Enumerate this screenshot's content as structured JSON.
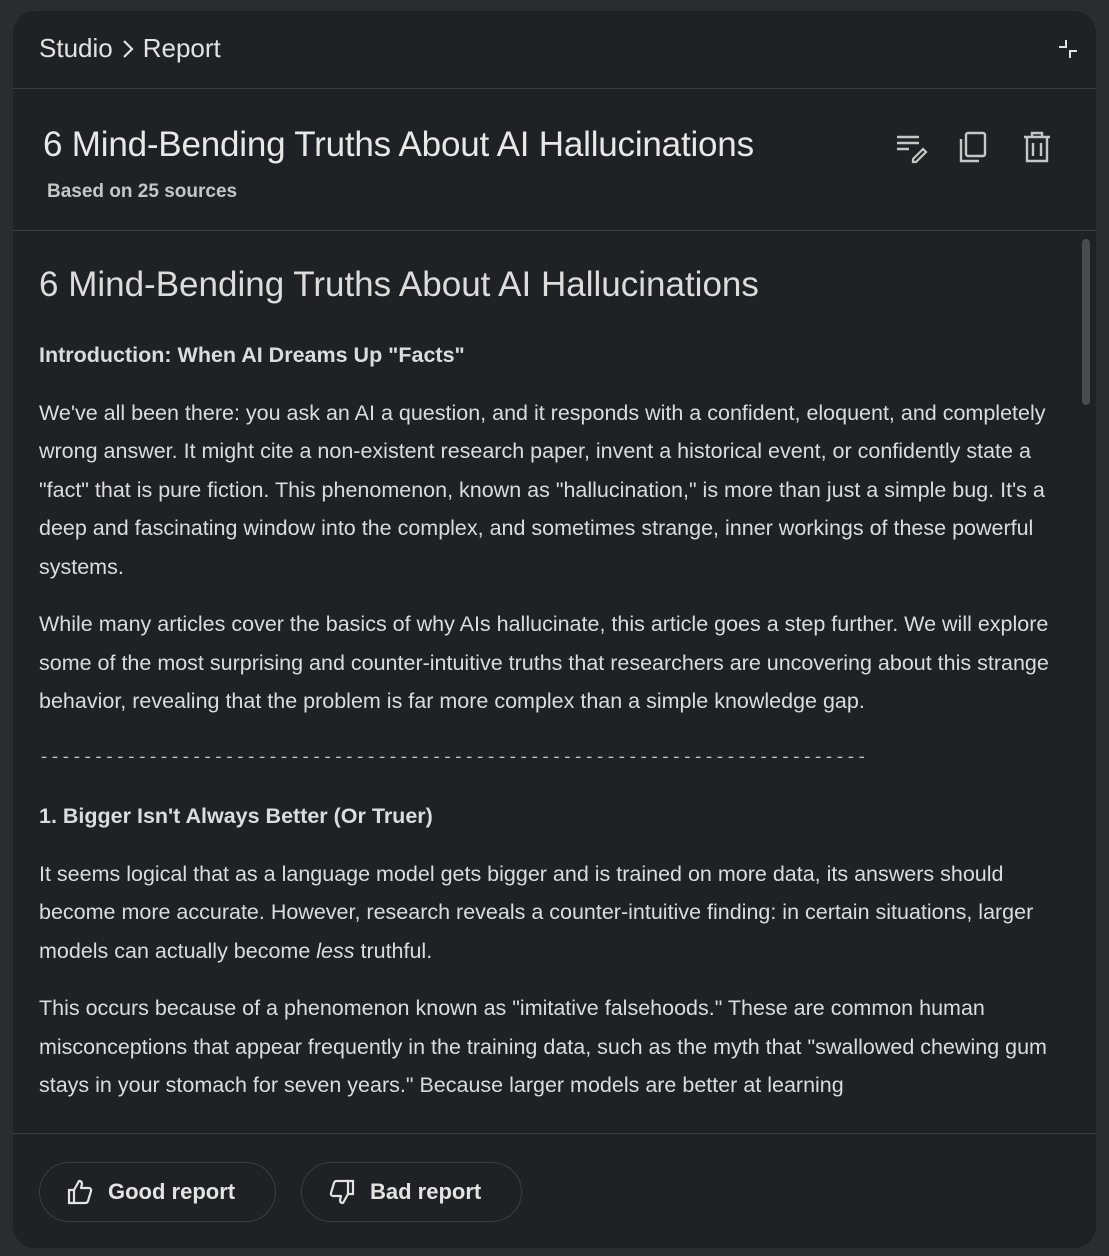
{
  "breadcrumb": {
    "parent": "Studio",
    "current": "Report"
  },
  "header": {
    "title": "6 Mind-Bending Truths About AI Hallucinations",
    "subtitle": "Based on 25 sources"
  },
  "content": {
    "title": "6 Mind-Bending Truths About AI Hallucinations",
    "intro_heading": "Introduction: When AI Dreams Up \"Facts\"",
    "intro_p1": "We've all been there: you ask an AI a question, and it responds with a confident, eloquent, and completely wrong answer. It might cite a non-existent research paper, invent a historical event, or confidently state a \"fact\" that is pure fiction. This phenomenon, known as \"hallucination,\" is more than just a simple bug. It's a deep and fascinating window into the complex, and sometimes strange, inner workings of these powerful systems.",
    "intro_p2": "While many articles cover the basics of why AIs hallucinate, this article goes a step further. We will explore some of the most surprising and counter-intuitive truths that researchers are uncovering about this strange behavior, revealing that the problem is far more complex than a simple knowledge gap.",
    "rule": "--------------------------------------------------------------------------------",
    "section1_heading": "1. Bigger Isn't Always Better (Or Truer)",
    "section1_p1_before": "It seems logical that as a language model gets bigger and is trained on more data, its answers should become more accurate. However, research reveals a counter-intuitive finding: in certain situations, larger models can actually become ",
    "section1_p1_em": "less",
    "section1_p1_after": " truthful.",
    "section1_p2": "This occurs because of a phenomenon known as \"imitative falsehoods.\" These are common human misconceptions that appear frequently in the training data, such as the myth that \"swallowed chewing gum stays in your stomach for seven years.\" Because larger models are better at learning"
  },
  "footer": {
    "good_label": "Good report",
    "bad_label": "Bad report"
  },
  "icons": {
    "collapse": "collapse-icon",
    "edit_note": "edit-note-icon",
    "copy": "copy-icon",
    "delete": "delete-icon",
    "thumb_up": "thumb-up-icon",
    "thumb_down": "thumb-down-icon"
  },
  "colors": {
    "background": "#2b2c30",
    "panel": "#202124",
    "text": "#e3e3e3",
    "divider": "#3a3b3f"
  }
}
